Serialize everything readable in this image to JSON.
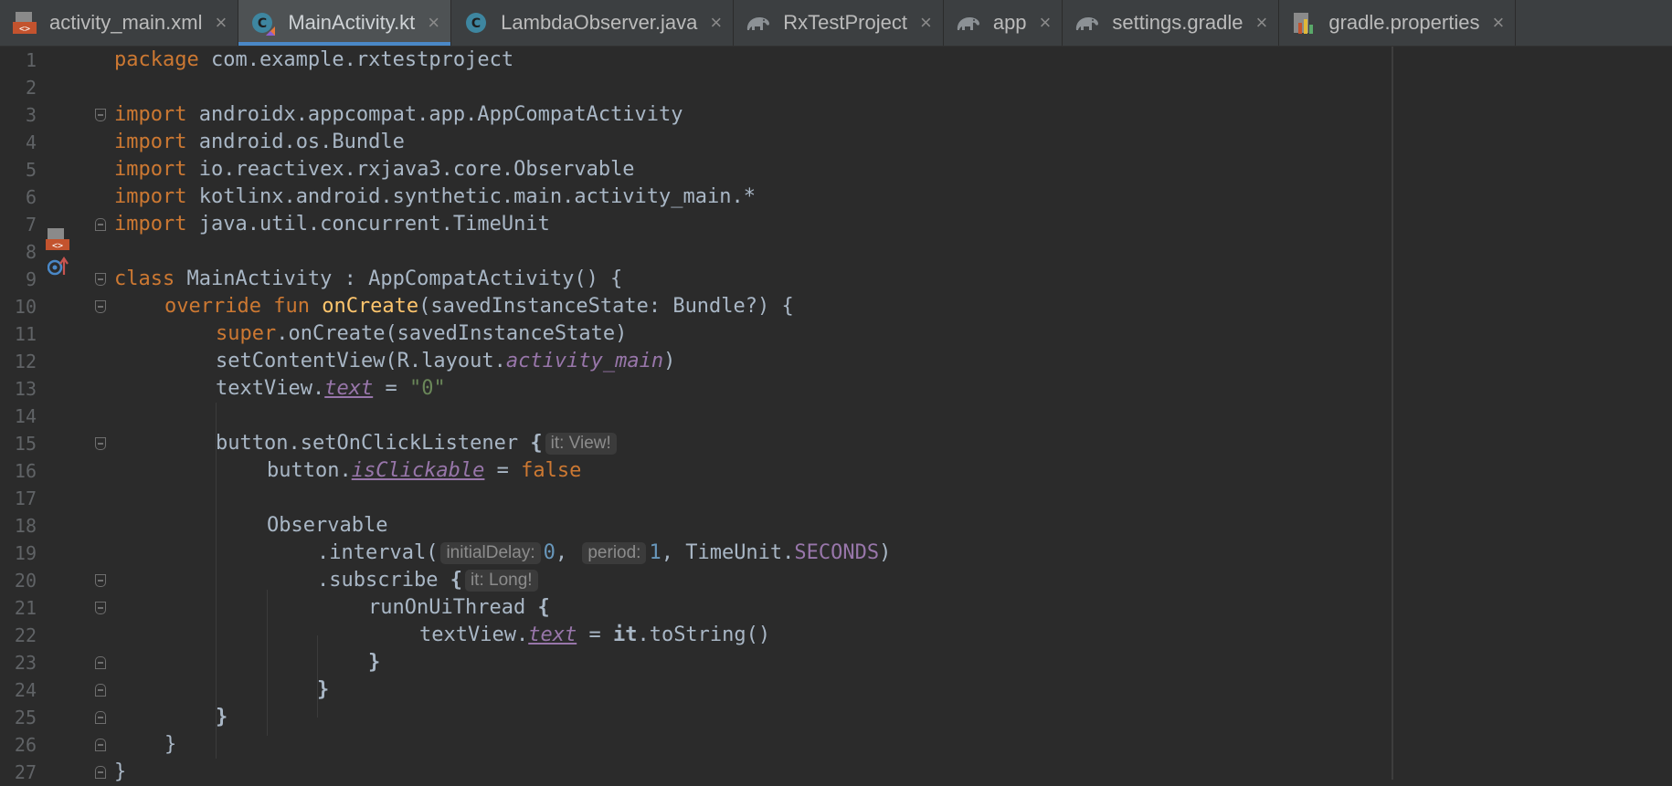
{
  "tabs": [
    {
      "label": "activity_main.xml",
      "icon": "xml-layout-icon",
      "active": false
    },
    {
      "label": "MainActivity.kt",
      "icon": "kotlin-class-icon",
      "active": true
    },
    {
      "label": "LambdaObserver.java",
      "icon": "java-class-icon",
      "active": false
    },
    {
      "label": "RxTestProject",
      "icon": "gradle-elephant-icon",
      "active": false
    },
    {
      "label": "app",
      "icon": "gradle-elephant-icon",
      "active": false
    },
    {
      "label": "settings.gradle",
      "icon": "gradle-elephant-icon",
      "active": false
    },
    {
      "label": "gradle.properties",
      "icon": "properties-file-icon",
      "active": false
    }
  ],
  "close_glyph": "×",
  "line_numbers": [
    "1",
    "2",
    "3",
    "4",
    "5",
    "6",
    "7",
    "8",
    "9",
    "10",
    "11",
    "12",
    "13",
    "14",
    "15",
    "16",
    "17",
    "18",
    "19",
    "20",
    "21",
    "22",
    "23",
    "24",
    "25",
    "26",
    "27"
  ],
  "code": {
    "l1": {
      "kw": "package",
      "rest": " com.example.rxtestproject"
    },
    "l3": {
      "kw": "import",
      "rest": " androidx.appcompat.app.AppCompatActivity"
    },
    "l4": {
      "kw": "import",
      "rest": " android.os.Bundle"
    },
    "l5": {
      "kw": "import",
      "rest": " io.reactivex.rxjava3.core.Observable"
    },
    "l6": {
      "kw": "import",
      "rest": " kotlinx.android.synthetic.main.activity_main.*"
    },
    "l7": {
      "kw": "import",
      "rest": " java.util.concurrent.TimeUnit"
    },
    "l9": {
      "kw": "class",
      "rest": " MainActivity : AppCompatActivity() {"
    },
    "l10": {
      "kw": "override fun",
      "fn": "onCreate",
      "rest": "(savedInstanceState: Bundle?) {"
    },
    "l11": {
      "kw": "super",
      "rest": ".onCreate(savedInstanceState)"
    },
    "l12": {
      "pre": "setContentView(R.layout.",
      "prop": "activity_main",
      "post": ")"
    },
    "l13": {
      "pre": "textView.",
      "prop": "text",
      "mid": " = ",
      "str": "\"0\""
    },
    "l15": {
      "pre": "button.setOnClickListener ",
      "bold": "{",
      "hint": "it: View!"
    },
    "l16": {
      "pre": "button.",
      "prop": "isClickable",
      "mid": " = ",
      "kw": "false"
    },
    "l18": {
      "pre": "Observable"
    },
    "l19": {
      "pre": ".interval(",
      "hint1": "initialDelay:",
      "n1": "0",
      "comma1": ",",
      "hint2": "period:",
      "n2": "1",
      "comma2": ", TimeUnit.",
      "const": "SECONDS",
      "post": ")"
    },
    "l20": {
      "pre": ".subscribe ",
      "bold": "{",
      "hint": "it: Long!"
    },
    "l21": {
      "pre": "runOnUiThread ",
      "bold": "{"
    },
    "l22": {
      "pre": "textView.",
      "prop": "text",
      "mid": " = ",
      "bold": "it",
      "post": ".toString()"
    },
    "l23": {
      "pre": "}"
    },
    "l24": {
      "pre": "}"
    },
    "l25": {
      "pre": "}"
    },
    "l26": {
      "pre": "}"
    },
    "l27": {
      "pre": "}"
    }
  },
  "colors": {
    "keyword": "#cc7832",
    "function": "#ffc66d",
    "string": "#6a8759",
    "number": "#6897bb",
    "property": "#9876aa",
    "text": "#a9b7c6",
    "background": "#2b2b2b",
    "tab_accent": "#4a88c7"
  }
}
